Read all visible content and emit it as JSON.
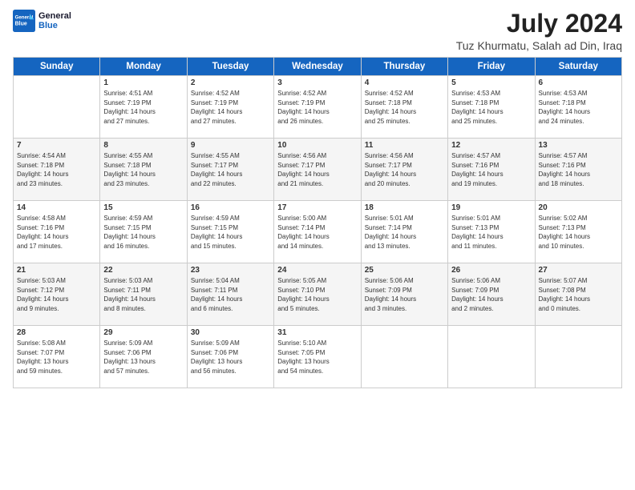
{
  "header": {
    "logo_line1": "General",
    "logo_line2": "Blue",
    "month": "July 2024",
    "location": "Tuz Khurmatu, Salah ad Din, Iraq"
  },
  "days_of_week": [
    "Sunday",
    "Monday",
    "Tuesday",
    "Wednesday",
    "Thursday",
    "Friday",
    "Saturday"
  ],
  "weeks": [
    [
      {
        "day": "",
        "info": ""
      },
      {
        "day": "1",
        "info": "Sunrise: 4:51 AM\nSunset: 7:19 PM\nDaylight: 14 hours\nand 27 minutes."
      },
      {
        "day": "2",
        "info": "Sunrise: 4:52 AM\nSunset: 7:19 PM\nDaylight: 14 hours\nand 27 minutes."
      },
      {
        "day": "3",
        "info": "Sunrise: 4:52 AM\nSunset: 7:19 PM\nDaylight: 14 hours\nand 26 minutes."
      },
      {
        "day": "4",
        "info": "Sunrise: 4:52 AM\nSunset: 7:18 PM\nDaylight: 14 hours\nand 25 minutes."
      },
      {
        "day": "5",
        "info": "Sunrise: 4:53 AM\nSunset: 7:18 PM\nDaylight: 14 hours\nand 25 minutes."
      },
      {
        "day": "6",
        "info": "Sunrise: 4:53 AM\nSunset: 7:18 PM\nDaylight: 14 hours\nand 24 minutes."
      }
    ],
    [
      {
        "day": "7",
        "info": "Sunrise: 4:54 AM\nSunset: 7:18 PM\nDaylight: 14 hours\nand 23 minutes."
      },
      {
        "day": "8",
        "info": "Sunrise: 4:55 AM\nSunset: 7:18 PM\nDaylight: 14 hours\nand 23 minutes."
      },
      {
        "day": "9",
        "info": "Sunrise: 4:55 AM\nSunset: 7:17 PM\nDaylight: 14 hours\nand 22 minutes."
      },
      {
        "day": "10",
        "info": "Sunrise: 4:56 AM\nSunset: 7:17 PM\nDaylight: 14 hours\nand 21 minutes."
      },
      {
        "day": "11",
        "info": "Sunrise: 4:56 AM\nSunset: 7:17 PM\nDaylight: 14 hours\nand 20 minutes."
      },
      {
        "day": "12",
        "info": "Sunrise: 4:57 AM\nSunset: 7:16 PM\nDaylight: 14 hours\nand 19 minutes."
      },
      {
        "day": "13",
        "info": "Sunrise: 4:57 AM\nSunset: 7:16 PM\nDaylight: 14 hours\nand 18 minutes."
      }
    ],
    [
      {
        "day": "14",
        "info": "Sunrise: 4:58 AM\nSunset: 7:16 PM\nDaylight: 14 hours\nand 17 minutes."
      },
      {
        "day": "15",
        "info": "Sunrise: 4:59 AM\nSunset: 7:15 PM\nDaylight: 14 hours\nand 16 minutes."
      },
      {
        "day": "16",
        "info": "Sunrise: 4:59 AM\nSunset: 7:15 PM\nDaylight: 14 hours\nand 15 minutes."
      },
      {
        "day": "17",
        "info": "Sunrise: 5:00 AM\nSunset: 7:14 PM\nDaylight: 14 hours\nand 14 minutes."
      },
      {
        "day": "18",
        "info": "Sunrise: 5:01 AM\nSunset: 7:14 PM\nDaylight: 14 hours\nand 13 minutes."
      },
      {
        "day": "19",
        "info": "Sunrise: 5:01 AM\nSunset: 7:13 PM\nDaylight: 14 hours\nand 11 minutes."
      },
      {
        "day": "20",
        "info": "Sunrise: 5:02 AM\nSunset: 7:13 PM\nDaylight: 14 hours\nand 10 minutes."
      }
    ],
    [
      {
        "day": "21",
        "info": "Sunrise: 5:03 AM\nSunset: 7:12 PM\nDaylight: 14 hours\nand 9 minutes."
      },
      {
        "day": "22",
        "info": "Sunrise: 5:03 AM\nSunset: 7:11 PM\nDaylight: 14 hours\nand 8 minutes."
      },
      {
        "day": "23",
        "info": "Sunrise: 5:04 AM\nSunset: 7:11 PM\nDaylight: 14 hours\nand 6 minutes."
      },
      {
        "day": "24",
        "info": "Sunrise: 5:05 AM\nSunset: 7:10 PM\nDaylight: 14 hours\nand 5 minutes."
      },
      {
        "day": "25",
        "info": "Sunrise: 5:06 AM\nSunset: 7:09 PM\nDaylight: 14 hours\nand 3 minutes."
      },
      {
        "day": "26",
        "info": "Sunrise: 5:06 AM\nSunset: 7:09 PM\nDaylight: 14 hours\nand 2 minutes."
      },
      {
        "day": "27",
        "info": "Sunrise: 5:07 AM\nSunset: 7:08 PM\nDaylight: 14 hours\nand 0 minutes."
      }
    ],
    [
      {
        "day": "28",
        "info": "Sunrise: 5:08 AM\nSunset: 7:07 PM\nDaylight: 13 hours\nand 59 minutes."
      },
      {
        "day": "29",
        "info": "Sunrise: 5:09 AM\nSunset: 7:06 PM\nDaylight: 13 hours\nand 57 minutes."
      },
      {
        "day": "30",
        "info": "Sunrise: 5:09 AM\nSunset: 7:06 PM\nDaylight: 13 hours\nand 56 minutes."
      },
      {
        "day": "31",
        "info": "Sunrise: 5:10 AM\nSunset: 7:05 PM\nDaylight: 13 hours\nand 54 minutes."
      },
      {
        "day": "",
        "info": ""
      },
      {
        "day": "",
        "info": ""
      },
      {
        "day": "",
        "info": ""
      }
    ]
  ]
}
